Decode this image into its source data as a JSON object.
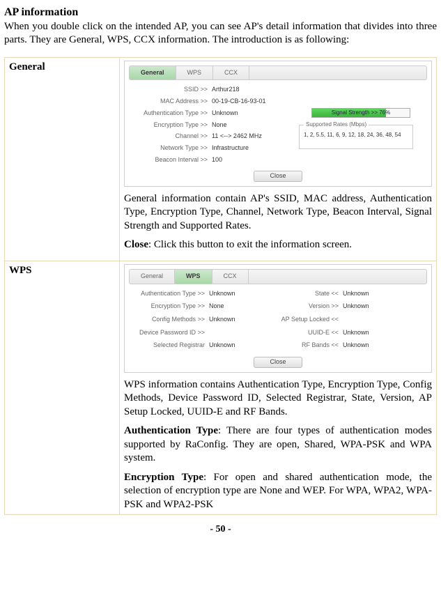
{
  "heading": "AP information",
  "intro": "When you double click on the intended AP, you can see AP's detail information that divides into three parts. They are General, WPS, CCX information. The introduction is as following:",
  "rows": {
    "general": {
      "label": "General",
      "tabs": {
        "general": "General",
        "wps": "WPS",
        "ccx": "CCX"
      },
      "fields": {
        "ssid_k": "SSID >>",
        "ssid_v": "Arthur218",
        "mac_k": "MAC Address >>",
        "mac_v": "00-19-CB-16-93-01",
        "auth_k": "Authentication Type >>",
        "auth_v": "Unknown",
        "enc_k": "Encryption Type >>",
        "enc_v": "None",
        "chan_k": "Channel >>",
        "chan_v": "11 <--> 2462 MHz",
        "nt_k": "Network Type >>",
        "nt_v": "Infrastructure",
        "bi_k": "Beacon Interval >>",
        "bi_v": "100"
      },
      "signal_label": "Signal Strength >> 76%",
      "rates_title": "Supported Rates (Mbps)",
      "rates_value": "1, 2, 5.5, 11, 6, 9, 12, 18, 24, 36, 48, 54",
      "close": "Close",
      "desc1": "General information contain AP's SSID, MAC address, Authentication Type, Encryption Type, Channel, Network Type, Beacon Interval, Signal Strength and Supported Rates.",
      "desc2_bold": "Close",
      "desc2_rest": ": Click this button to exit the information screen."
    },
    "wps": {
      "label": "WPS",
      "tabs": {
        "general": "General",
        "wps": "WPS",
        "ccx": "CCX"
      },
      "fields": {
        "auth_k": "Authentication Type >>",
        "auth_v": "Unknown",
        "enc_k": "Encryption Type >>",
        "enc_v": "None",
        "cfg_k": "Config Methods >>",
        "cfg_v": "Unknown",
        "dpw_k": "Device Password ID >>",
        "dpw_v": "",
        "sr_k": "Selected Registrar",
        "sr_v": "Unknown",
        "state_k": "State <<",
        "state_v": "Unknown",
        "ver_k": "Version >>",
        "ver_v": "Unknown",
        "apsl_k": "AP Setup Locked <<",
        "apsl_v": "",
        "uuid_k": "UUID-E <<",
        "uuid_v": "Unknown",
        "rfb_k": "RF Bands <<",
        "rfb_v": "Unknown"
      },
      "close": "Close",
      "desc1": "WPS information contains Authentication Type, Encryption Type, Config Methods, Device Password ID, Selected Registrar, State, Version, AP Setup Locked, UUID-E and RF Bands.",
      "auth_bold": "Authentication Type",
      "auth_rest": ": There are four types of authentication modes supported by RaConfig. They are open, Shared, WPA-PSK and WPA system.",
      "enc_bold": "Encryption Type",
      "enc_rest": ": For open and shared authentication mode, the selection of encryption type are None and WEP. For WPA, WPA2, WPA-PSK and WPA2-PSK"
    }
  },
  "page_number": "- 50 -"
}
